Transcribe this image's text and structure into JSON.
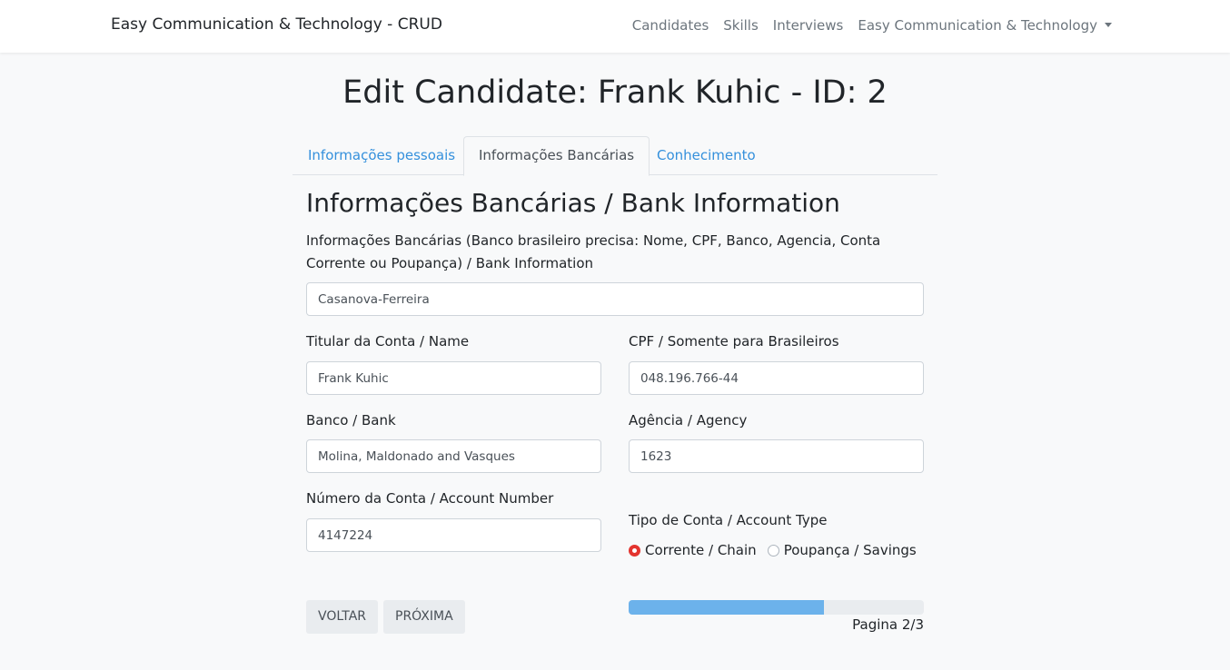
{
  "navbar": {
    "brand": "Easy Communication & Technology - CRUD",
    "links": [
      "Candidates",
      "Skills",
      "Interviews"
    ],
    "dropdown": "Easy Communication & Technology"
  },
  "page": {
    "title": "Edit Candidate: Frank Kuhic - ID: 2"
  },
  "tabs": [
    {
      "label": "Informações pessoais",
      "active": false
    },
    {
      "label": "Informações Bancárias",
      "active": true
    },
    {
      "label": "Conhecimento",
      "active": false
    }
  ],
  "form": {
    "section_title": "Informações Bancárias / Bank Information",
    "description": "Informações Bancárias (Banco brasileiro precisa: Nome, CPF, Banco, Agencia, Conta Corrente ou Poupança) / Bank Information",
    "bank_info_value": "Casanova-Ferreira",
    "holder": {
      "label": "Titular da Conta / Name",
      "value": "Frank Kuhic"
    },
    "cpf": {
      "label": "CPF / Somente para Brasileiros",
      "value": "048.196.766-44"
    },
    "bank": {
      "label": "Banco / Bank",
      "value": "Molina, Maldonado and Vasques"
    },
    "agency": {
      "label": "Agência / Agency",
      "value": "1623"
    },
    "account_number": {
      "label": "Número da Conta / Account Number",
      "value": "4147224"
    },
    "account_type": {
      "label": "Tipo de Conta / Account Type",
      "options": [
        {
          "label": "Corrente / Chain",
          "checked": true
        },
        {
          "label": "Poupança / Savings",
          "checked": false
        }
      ]
    }
  },
  "buttons": {
    "back": "VOLTAR",
    "next": "PRÓXIMA"
  },
  "progress": {
    "percent": 66,
    "label": "Pagina 2/3"
  },
  "colors": {
    "link": "#3490dc",
    "progress": "#6cb2eb",
    "radio_checked": "#e3342f"
  }
}
